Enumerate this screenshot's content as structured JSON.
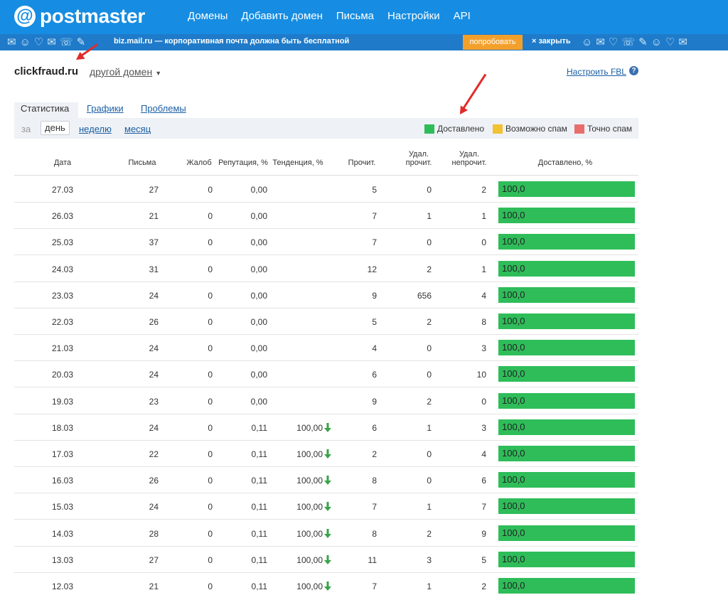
{
  "app": {
    "logo_at": "@",
    "logo_text": "postmaster"
  },
  "nav": [
    "Домены",
    "Добавить домен",
    "Письма",
    "Настройки",
    "API"
  ],
  "promo": {
    "text": "biz.mail.ru — корпоративная почта должна быть бесплатной",
    "try_label": "попробовать",
    "close_label": "× закрыть",
    "doodles_left": "✉☺♡✉☏✎",
    "doodles_right": "☺✉♡☏✎☺♡✉"
  },
  "domain": {
    "name": "clickfraud.ru",
    "switch_label": "другой домен"
  },
  "fbl_label": "Настроить FBL",
  "help_glyph": "?",
  "tabs": [
    "Статистика",
    "Графики",
    "Проблемы"
  ],
  "period": {
    "label": "за",
    "options": [
      "день",
      "неделю",
      "месяц"
    ],
    "selected": "день"
  },
  "legend": [
    {
      "label": "Доставлено",
      "color": "#2ebd59"
    },
    {
      "label": "Возможно спам",
      "color": "#f1c232"
    },
    {
      "label": "Точно спам",
      "color": "#e96d6d"
    }
  ],
  "columns": {
    "date": "Дата",
    "letters": "Письма",
    "complaints": "Жалоб",
    "reputation": "Репутация, %",
    "trend": "Тенденция, %",
    "read": "Прочит.",
    "deleted_read": [
      "Удал.",
      "прочит."
    ],
    "deleted_unread": [
      "Удал.",
      "непрочит."
    ],
    "delivered": "Доставлено, %"
  },
  "rows": [
    {
      "date": "27.03",
      "letters": "27",
      "complaints": "0",
      "reputation": "0,00",
      "trend": "",
      "read": "5",
      "deleted_read": "0",
      "deleted_unread": "2",
      "delivered": "100,0"
    },
    {
      "date": "26.03",
      "letters": "21",
      "complaints": "0",
      "reputation": "0,00",
      "trend": "",
      "read": "7",
      "deleted_read": "1",
      "deleted_unread": "1",
      "delivered": "100,0"
    },
    {
      "date": "25.03",
      "letters": "37",
      "complaints": "0",
      "reputation": "0,00",
      "trend": "",
      "read": "7",
      "deleted_read": "0",
      "deleted_unread": "0",
      "delivered": "100,0"
    },
    {
      "date": "24.03",
      "letters": "31",
      "complaints": "0",
      "reputation": "0,00",
      "trend": "",
      "read": "12",
      "deleted_read": "2",
      "deleted_unread": "1",
      "delivered": "100,0"
    },
    {
      "date": "23.03",
      "letters": "24",
      "complaints": "0",
      "reputation": "0,00",
      "trend": "",
      "read": "9",
      "deleted_read": "656",
      "deleted_unread": "4",
      "delivered": "100,0"
    },
    {
      "date": "22.03",
      "letters": "26",
      "complaints": "0",
      "reputation": "0,00",
      "trend": "",
      "read": "5",
      "deleted_read": "2",
      "deleted_unread": "8",
      "delivered": "100,0"
    },
    {
      "date": "21.03",
      "letters": "24",
      "complaints": "0",
      "reputation": "0,00",
      "trend": "",
      "read": "4",
      "deleted_read": "0",
      "deleted_unread": "3",
      "delivered": "100,0"
    },
    {
      "date": "20.03",
      "letters": "24",
      "complaints": "0",
      "reputation": "0,00",
      "trend": "",
      "read": "6",
      "deleted_read": "0",
      "deleted_unread": "10",
      "delivered": "100,0"
    },
    {
      "date": "19.03",
      "letters": "23",
      "complaints": "0",
      "reputation": "0,00",
      "trend": "",
      "read": "9",
      "deleted_read": "2",
      "deleted_unread": "0",
      "delivered": "100,0"
    },
    {
      "date": "18.03",
      "letters": "24",
      "complaints": "0",
      "reputation": "0,11",
      "trend": "100,00",
      "read": "6",
      "deleted_read": "1",
      "deleted_unread": "3",
      "delivered": "100,0"
    },
    {
      "date": "17.03",
      "letters": "22",
      "complaints": "0",
      "reputation": "0,11",
      "trend": "100,00",
      "read": "2",
      "deleted_read": "0",
      "deleted_unread": "4",
      "delivered": "100,0"
    },
    {
      "date": "16.03",
      "letters": "26",
      "complaints": "0",
      "reputation": "0,11",
      "trend": "100,00",
      "read": "8",
      "deleted_read": "0",
      "deleted_unread": "6",
      "delivered": "100,0"
    },
    {
      "date": "15.03",
      "letters": "24",
      "complaints": "0",
      "reputation": "0,11",
      "trend": "100,00",
      "read": "7",
      "deleted_read": "1",
      "deleted_unread": "7",
      "delivered": "100,0"
    },
    {
      "date": "14.03",
      "letters": "28",
      "complaints": "0",
      "reputation": "0,11",
      "trend": "100,00",
      "read": "8",
      "deleted_read": "2",
      "deleted_unread": "9",
      "delivered": "100,0"
    },
    {
      "date": "13.03",
      "letters": "27",
      "complaints": "0",
      "reputation": "0,11",
      "trend": "100,00",
      "read": "11",
      "deleted_read": "3",
      "deleted_unread": "5",
      "delivered": "100,0"
    },
    {
      "date": "12.03",
      "letters": "21",
      "complaints": "0",
      "reputation": "0,11",
      "trend": "100,00",
      "read": "7",
      "deleted_read": "1",
      "deleted_unread": "2",
      "delivered": "100,0"
    }
  ],
  "colors": {
    "header_bg": "#168de2",
    "promo_bg": "#1f7bc9",
    "try_button": "#f3a02b",
    "delivered": "#2ebd59",
    "trend_down": "#3aa34a",
    "annotation_arrow": "#e12b2b"
  }
}
